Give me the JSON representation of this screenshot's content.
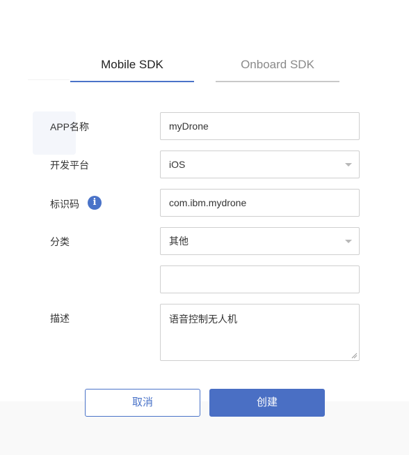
{
  "tabs": [
    {
      "label": "Mobile SDK",
      "active": true
    },
    {
      "label": "Onboard SDK",
      "active": false
    }
  ],
  "form": {
    "app_name": {
      "label": "APP名称",
      "value": "myDrone"
    },
    "platform": {
      "label": "开发平台",
      "value": "iOS"
    },
    "bundle_id": {
      "label": "标识码",
      "value": "com.ibm.mydrone"
    },
    "category": {
      "label": "分类",
      "value": "其他"
    },
    "category_other": {
      "value": ""
    },
    "description": {
      "label": "描述",
      "value": "语音控制无人机"
    }
  },
  "buttons": {
    "cancel": "取消",
    "create": "创建"
  },
  "colors": {
    "accent": "#4a73c8",
    "primary_button": "#4a6fc4",
    "inactive_tab": "#c8c8c8"
  }
}
